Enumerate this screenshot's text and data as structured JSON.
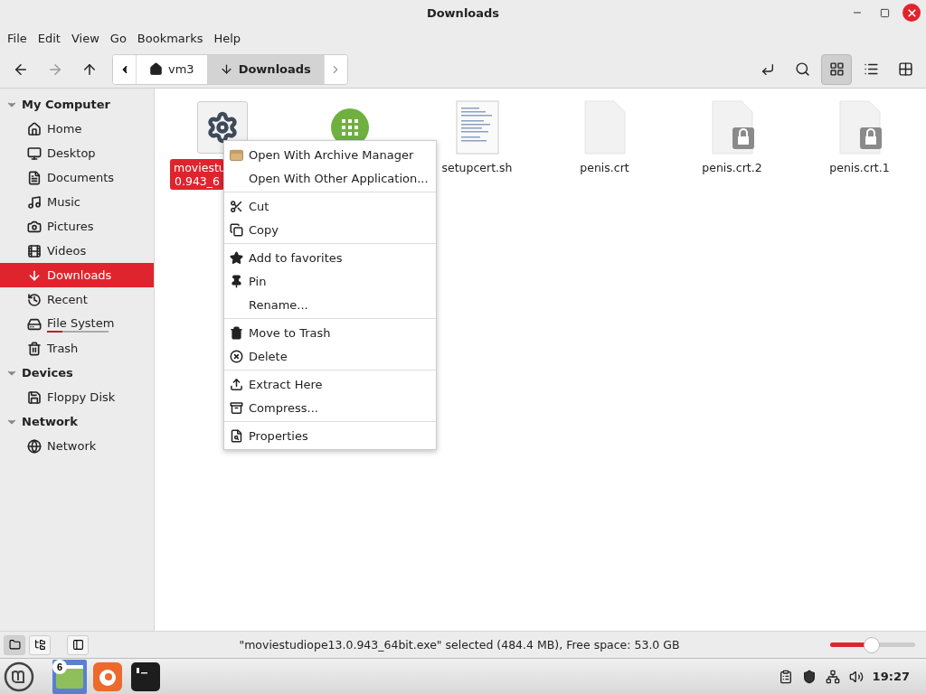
{
  "window": {
    "title": "Downloads"
  },
  "menu_bar": [
    "File",
    "Edit",
    "View",
    "Go",
    "Bookmarks",
    "Help"
  ],
  "toolbar": {
    "back": {
      "disabled": false
    },
    "forward": {
      "disabled": true
    },
    "path": [
      {
        "label": "vm3",
        "kind": "home",
        "selected": false
      },
      {
        "label": "Downloads",
        "kind": "download",
        "selected": true
      }
    ],
    "views": [
      {
        "kind": "icons",
        "selected": true
      },
      {
        "kind": "list",
        "selected": false
      },
      {
        "kind": "compact",
        "selected": false
      }
    ]
  },
  "sidebar": {
    "sections": [
      {
        "title": "My Computer",
        "expanded": true,
        "items": [
          {
            "label": "Home",
            "kind": "home",
            "selected": false
          },
          {
            "label": "Desktop",
            "kind": "desktop",
            "selected": false
          },
          {
            "label": "Documents",
            "kind": "document",
            "selected": false
          },
          {
            "label": "Music",
            "kind": "music",
            "selected": false
          },
          {
            "label": "Pictures",
            "kind": "camera",
            "selected": false
          },
          {
            "label": "Videos",
            "kind": "film",
            "selected": false
          },
          {
            "label": "Downloads",
            "kind": "download",
            "selected": true
          },
          {
            "label": "Recent",
            "kind": "history",
            "selected": false
          },
          {
            "label": "File System",
            "kind": "disk",
            "selected": false,
            "level": 0.25
          },
          {
            "label": "Trash",
            "kind": "trash",
            "selected": false
          }
        ]
      },
      {
        "title": "Devices",
        "expanded": true,
        "items": [
          {
            "label": "Floppy Disk",
            "kind": "floppy",
            "selected": false
          }
        ]
      },
      {
        "title": "Network",
        "expanded": true,
        "items": [
          {
            "label": "Network",
            "kind": "globe",
            "selected": false
          }
        ]
      }
    ]
  },
  "files": [
    {
      "name_lines": [
        "moviestu",
        "0.943_6"
      ],
      "kind": "gear",
      "selected": true
    },
    {
      "kind": "app",
      "selected": false
    },
    {
      "name_lines": [
        "setupcert.sh"
      ],
      "kind": "script",
      "selected": false
    },
    {
      "name_lines": [
        "penis.crt"
      ],
      "kind": "cert",
      "selected": false
    },
    {
      "name_lines": [
        "penis.crt.2"
      ],
      "kind": "locked",
      "selected": false
    },
    {
      "name_lines": [
        "penis.crt.1"
      ],
      "kind": "locked",
      "selected": false
    }
  ],
  "context_menu": [
    [
      {
        "label": "Open With Archive Manager",
        "kind": "archive"
      },
      {
        "label": "Open With Other Application...",
        "kind": "none"
      }
    ],
    [
      {
        "label": "Cut",
        "kind": "cut"
      },
      {
        "label": "Copy",
        "kind": "copy"
      }
    ],
    [
      {
        "label": "Add to favorites",
        "kind": "star"
      },
      {
        "label": "Pin",
        "kind": "pin"
      },
      {
        "label": "Rename...",
        "kind": "none"
      }
    ],
    [
      {
        "label": "Move to Trash",
        "kind": "trash"
      },
      {
        "label": "Delete",
        "kind": "delete"
      }
    ],
    [
      {
        "label": "Extract Here",
        "kind": "extract"
      },
      {
        "label": "Compress...",
        "kind": "compress"
      }
    ],
    [
      {
        "label": "Properties",
        "kind": "properties"
      }
    ]
  ],
  "status_bar": {
    "pane_buttons": [
      {
        "kind": "places",
        "selected": true
      },
      {
        "kind": "tree",
        "selected": false
      }
    ],
    "text": "\"moviestudiope13.0.943_64bit.exe\" selected (484.4 MB), Free space: 53.0 GB",
    "zoom": {
      "level": 0.49
    }
  },
  "taskbar": {
    "apps": [
      {
        "kind": "files",
        "selected": true,
        "badge": "6"
      },
      {
        "kind": "firefox",
        "selected": false
      },
      {
        "kind": "terminal",
        "selected": false
      }
    ],
    "clock": "19:27"
  }
}
